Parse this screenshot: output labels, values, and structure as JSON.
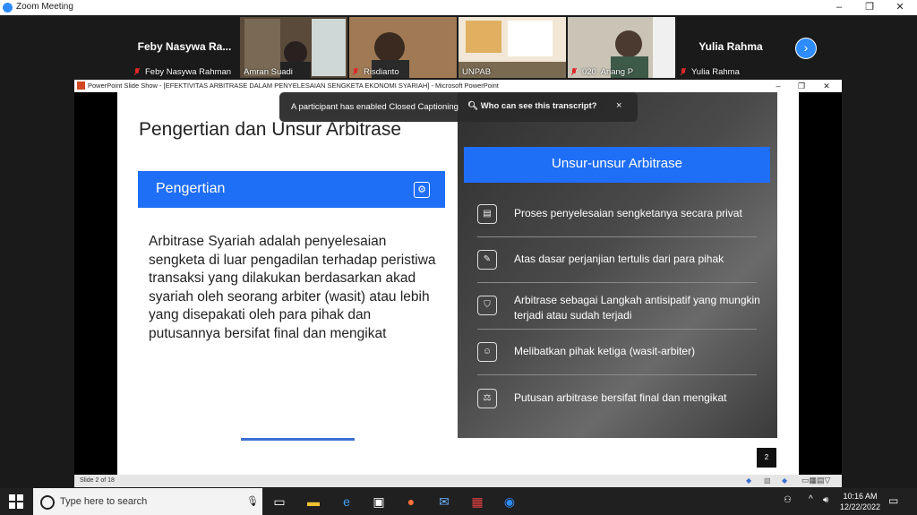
{
  "zoom": {
    "window_title": "Zoom Meeting",
    "win_min": "–",
    "win_max": "❐",
    "win_close": "✕",
    "participants": [
      {
        "name_large": "Feby Nasywa Ra...",
        "label": "Feby Nasywa Rahman"
      },
      {
        "label": "Amran Suadi"
      },
      {
        "label": "Risdianto"
      },
      {
        "label": "UNPAB"
      },
      {
        "label": "020. Anang P"
      },
      {
        "name_large": "Yulia Rahma",
        "label": "Yulia Rahma"
      }
    ],
    "next_icon": "chevron-right-icon"
  },
  "ppt": {
    "window_title": "PowerPoint Slide Show - [EFEKTIVITAS ARBITRASE DALAM PENYELESAIAN SENGKETA EKONOMI SYARIAH] - Microsoft PowerPoint",
    "status": "Slide 2 of 18"
  },
  "slide": {
    "title": "Pengertian dan Unsur Arbitrase",
    "pengertian_label": "Pengertian",
    "definition": "Arbitrase Syariah adalah penyelesaian sengketa di luar pengadilan terhadap peristiwa transaksi yang dilakukan berdasarkan akad syariah oleh seorang arbiter (wasit) atau lebih yang disepakati oleh para pihak dan putusannya bersifat final dan mengikat",
    "unsur_label": "Unsur-unsur Arbitrase",
    "items": [
      {
        "icon": "document-icon",
        "text": "Proses penyelesaian sengketanya secara privat"
      },
      {
        "icon": "contract-icon",
        "text": "Atas dasar perjanjian tertulis dari para pihak"
      },
      {
        "icon": "shield-user-icon",
        "text": "Arbitrase sebagai Langkah antisipatif yang mungkin terjadi atau sudah terjadi"
      },
      {
        "icon": "people-icon",
        "text": "Melibatkan pihak ketiga (wasit-arbiter)"
      },
      {
        "icon": "gavel-icon",
        "text": "Putusan arbitrase bersifat final dan mengikat"
      }
    ],
    "page_number": "2"
  },
  "caption_toast": {
    "message": "A participant has enabled Closed Captioning",
    "link": "Who can see this transcript?",
    "close": "×"
  },
  "taskbar": {
    "search_placeholder": "Type here to search",
    "time": "10:16 AM",
    "date": "12/22/2022"
  }
}
